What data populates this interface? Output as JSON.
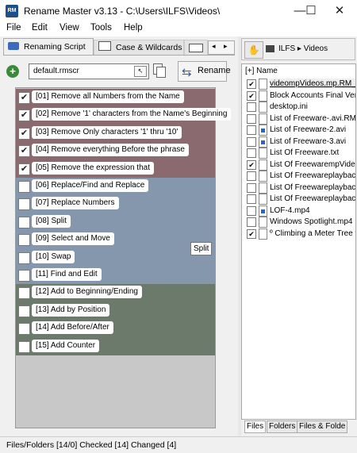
{
  "window": {
    "title": "Rename Master v3.13 - C:\\Users\\ILFS\\Videos\\",
    "app_icon_text": "RM",
    "minimize": "—",
    "maximize": "☐",
    "close": "✕"
  },
  "menu": [
    "File",
    "Edit",
    "View",
    "Tools",
    "Help"
  ],
  "tabs": {
    "script": "Renaming Script",
    "case": "Case & Wildcards"
  },
  "script_file": "default.rmscr",
  "rename_label": "Rename",
  "rules": [
    {
      "label": "[01] Remove all Numbers from the Name",
      "checked": true,
      "group": "remove"
    },
    {
      "label": "[02] Remove '1' characters from the Name's Beginning",
      "checked": true,
      "group": "remove"
    },
    {
      "label": "[03] Remove Only characters '1' thru '10'",
      "checked": true,
      "group": "remove"
    },
    {
      "label": "[04] Remove everything Before the phrase",
      "checked": true,
      "group": "remove"
    },
    {
      "label": "[05] Remove the expression that",
      "checked": true,
      "group": "remove"
    },
    {
      "label": "[06] Replace/Find and Replace",
      "checked": false,
      "group": "replace"
    },
    {
      "label": "[07] Replace Numbers",
      "checked": false,
      "group": "replace"
    },
    {
      "label": "[08] Split",
      "checked": false,
      "group": "replace"
    },
    {
      "label": "[09] Select and Move",
      "checked": false,
      "group": "replace"
    },
    {
      "label": "[10] Swap",
      "checked": false,
      "group": "replace"
    },
    {
      "label": "[11] Find and Edit",
      "checked": false,
      "group": "replace"
    },
    {
      "label": "[12] Add to Beginning/Ending",
      "checked": false,
      "group": "add"
    },
    {
      "label": "[13] Add by Position",
      "checked": false,
      "group": "add"
    },
    {
      "label": "[14] Add Before/After",
      "checked": false,
      "group": "add"
    },
    {
      "label": "[15] Add Counter",
      "checked": false,
      "group": "add"
    }
  ],
  "tooltip": "Split",
  "path": {
    "folder": "ILFS",
    "sub": "Videos"
  },
  "name_header": "[+] Name",
  "files": [
    {
      "name": "videompVideos.mp.RM_T",
      "checked": true,
      "icon": "file"
    },
    {
      "name": "Block Accounts Final Versio",
      "checked": true,
      "icon": "file"
    },
    {
      "name": "desktop.ini",
      "checked": false,
      "icon": "file"
    },
    {
      "name": "List of Freeware-.avi.RM_",
      "checked": false,
      "icon": "file"
    },
    {
      "name": "List of Freeware-2.avi",
      "checked": false,
      "icon": "media"
    },
    {
      "name": "List of Freeware-3.avi",
      "checked": false,
      "icon": "media"
    },
    {
      "name": "List Of Freeware.txt",
      "checked": false,
      "icon": "file"
    },
    {
      "name": "List Of FreewarempVideos",
      "checked": true,
      "icon": "file"
    },
    {
      "name": "List Of Freewareplayback",
      "checked": false,
      "icon": "file"
    },
    {
      "name": "List Of Freewareplayback",
      "checked": false,
      "icon": "file"
    },
    {
      "name": "List Of Freewareplayback",
      "checked": false,
      "icon": "file"
    },
    {
      "name": "LOF-4.mp4",
      "checked": false,
      "icon": "media"
    },
    {
      "name": "Windows Spotlight.mp4",
      "checked": false,
      "icon": "file"
    },
    {
      "name": "º Climbing a  Meter Tree w",
      "checked": true,
      "icon": "file"
    }
  ],
  "bottom_tabs": [
    "Files",
    "Folders",
    "Files & Folde"
  ],
  "status": "Files/Folders [14/0] Checked [14] Changed [4]"
}
